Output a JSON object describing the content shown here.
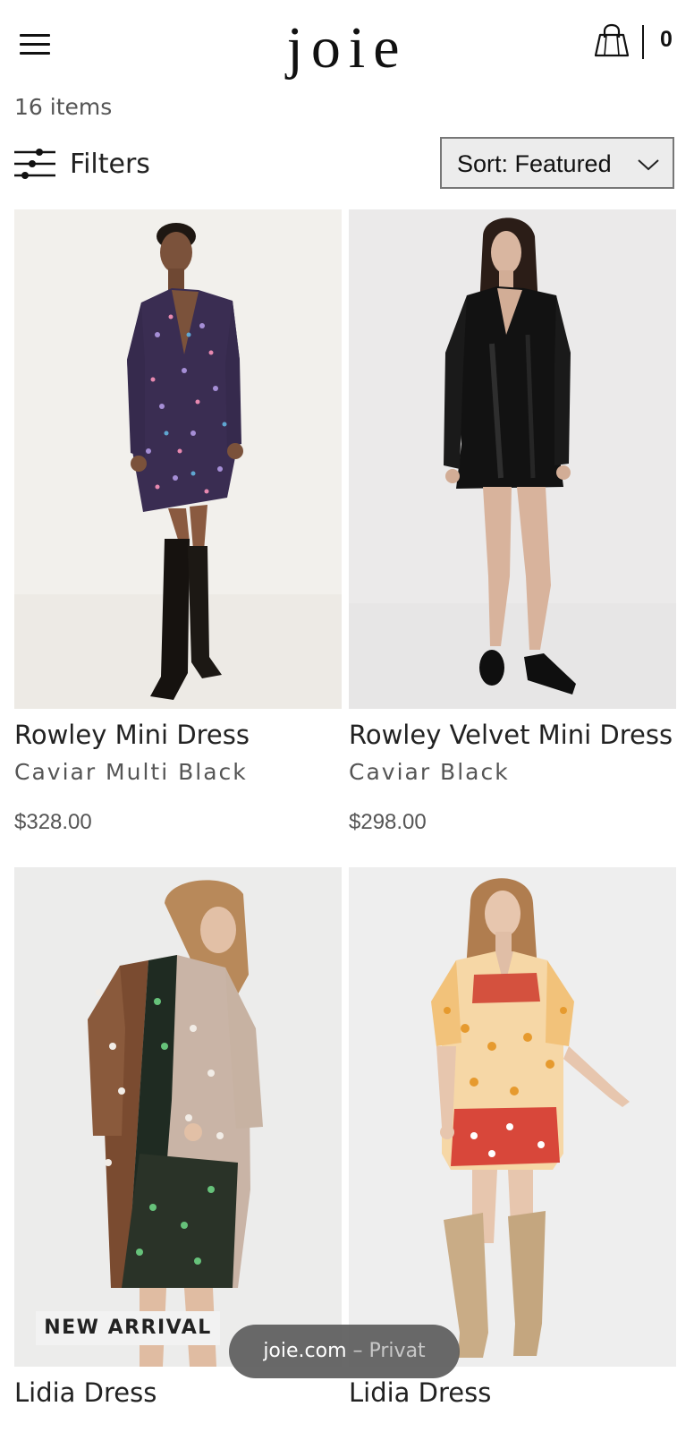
{
  "header": {
    "menu_icon": "hamburger-menu-icon",
    "logo_text": "joie",
    "bag_icon": "shopping-bag-icon",
    "cart_count": "0"
  },
  "listing": {
    "item_count": "16 items",
    "filters_label": "Filters",
    "filters_icon": "sliders-icon",
    "sort_label": "Sort: Featured",
    "sort_icon": "chevron-down-icon"
  },
  "products": [
    {
      "name": "Rowley Mini Dress",
      "color": "Caviar Multi Black",
      "price": "$328.00",
      "image_bg": "#f2f0ec"
    },
    {
      "name": "Rowley Velvet Mini Dress",
      "color": "Caviar Black",
      "price": "$298.00",
      "image_bg": "#ebeaea"
    },
    {
      "name": "Lidia Dress",
      "badge": "NEW ARRIVAL",
      "image_bg": "#ececeb"
    },
    {
      "name": "Lidia Dress",
      "image_bg": "#eeeeee"
    }
  ],
  "browser": {
    "url_host": "joie.com",
    "url_suffix": "– Privat"
  }
}
